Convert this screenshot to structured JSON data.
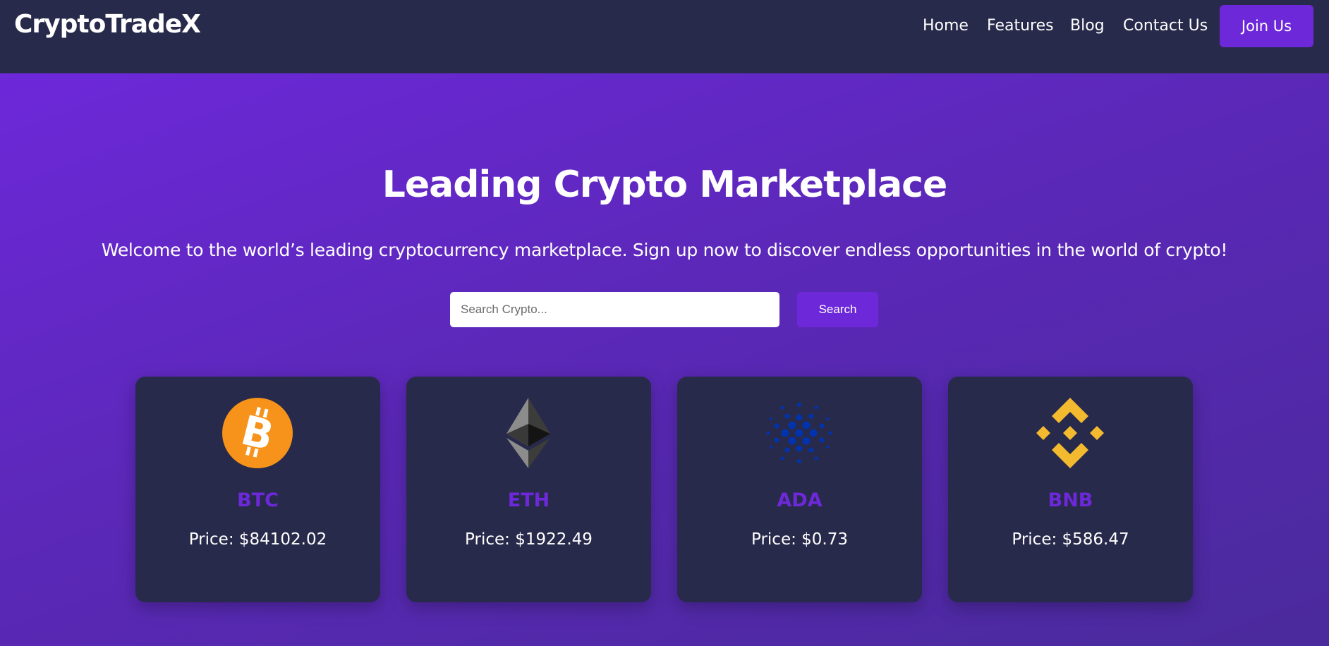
{
  "navbar": {
    "logo": "CryptoTradeX",
    "links": [
      "Home",
      "Features",
      "Blog",
      "Contact Us"
    ],
    "join_label": "Join Us"
  },
  "hero": {
    "title": "Leading Crypto Marketplace",
    "subtitle": "Welcome to the world’s leading cryptocurrency marketplace. Sign up now to discover endless opportunities in the world of crypto!",
    "search_placeholder": "Search Crypto...",
    "search_value": "",
    "search_button": "Search"
  },
  "cards": [
    {
      "symbol": "BTC",
      "price": "Price: $84102.02",
      "icon": "bitcoin-icon"
    },
    {
      "symbol": "ETH",
      "price": "Price: $1922.49",
      "icon": "ethereum-icon"
    },
    {
      "symbol": "ADA",
      "price": "Price: $0.73",
      "icon": "cardano-icon"
    },
    {
      "symbol": "BNB",
      "price": "Price: $586.47",
      "icon": "binance-icon"
    }
  ],
  "colors": {
    "navbar_bg": "#282a4b",
    "accent": "#6d28d9",
    "hero_gradient_start": "#6d28d9",
    "hero_gradient_end": "#4a2a9c",
    "bitcoin_orange": "#f7931a",
    "cardano_blue": "#0033ad",
    "binance_yellow": "#f3ba2f"
  }
}
